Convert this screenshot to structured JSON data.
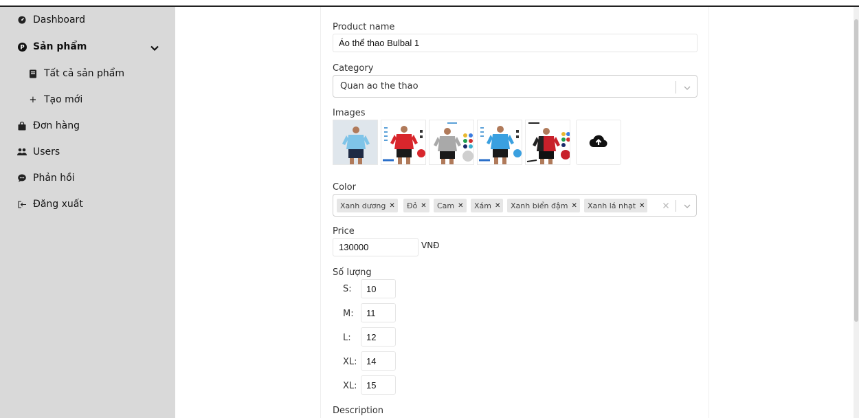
{
  "sidebar": {
    "items": [
      {
        "label": "Dashboard",
        "icon": "gauge-icon"
      },
      {
        "label": "Sản phẩm",
        "icon": "p-circle-icon"
      },
      {
        "label": "Tất cả sản phẩm",
        "icon": "book-icon"
      },
      {
        "label": "Tạo mới",
        "icon": "plus-icon"
      },
      {
        "label": "Đơn hàng",
        "icon": "shopping-bag-icon"
      },
      {
        "label": "Users",
        "icon": "users-icon"
      },
      {
        "label": "Phản hồi",
        "icon": "comment-icon"
      },
      {
        "label": "Đăng xuất",
        "icon": "sign-out-icon"
      }
    ]
  },
  "form": {
    "product_name_label": "Product name",
    "product_name_value": "Áo thể thao Bulbal 1",
    "category_label": "Category",
    "category_value": "Quan ao the thao",
    "images_label": "Images",
    "images": [
      {
        "shirt": "#7fc4e8",
        "shorts": "#1e2a44",
        "accent": "#ffffff"
      },
      {
        "shirt": "#d8262c",
        "shorts": "#1a1a1a",
        "accent": "#2a6fc9"
      },
      {
        "shirt": "#a9a9a9",
        "shorts": "#1a1a1a",
        "accent": "#d0d0d0"
      },
      {
        "shirt": "#3aa0e0",
        "shorts": "#1a1a1a",
        "accent": "#2a6fc9"
      },
      {
        "shirt": "#c8202a",
        "shorts": "#111111",
        "accent": "#222222"
      }
    ],
    "color_label": "Color",
    "colors": [
      "Xanh dương",
      "Đỏ",
      "Cam",
      "Xám",
      "Xanh biển đậm",
      "Xanh lá nhạt"
    ],
    "price_label": "Price",
    "price_value": "130000",
    "price_unit": "VNĐ",
    "quantity_label": "Số lượng",
    "sizes": [
      {
        "size": "S:",
        "qty": "10"
      },
      {
        "size": "M:",
        "qty": "11"
      },
      {
        "size": "L:",
        "qty": "12"
      },
      {
        "size": "XL:",
        "qty": "14"
      },
      {
        "size": "XL:",
        "qty": "15"
      }
    ],
    "description_label": "Description"
  }
}
